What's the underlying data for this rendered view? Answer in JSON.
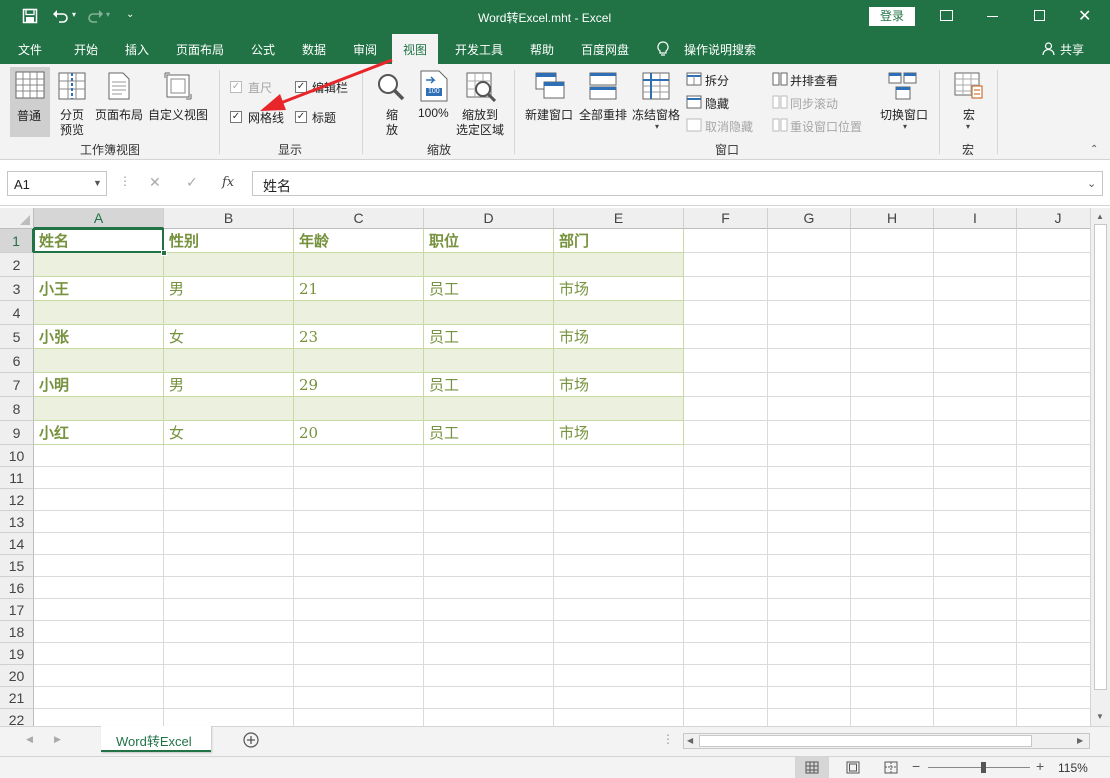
{
  "window": {
    "title": "Word转Excel.mht  -  Excel",
    "login_label": "登录"
  },
  "tabs": [
    "文件",
    "开始",
    "插入",
    "页面布局",
    "公式",
    "数据",
    "审阅",
    "视图",
    "开发工具",
    "帮助",
    "百度网盘"
  ],
  "active_tab": "视图",
  "tell_me": "操作说明搜索",
  "share_label": "共享",
  "ribbon": {
    "workbook_views": {
      "normal": "普通",
      "page_break_line1": "分页",
      "page_break_line2": "预览",
      "page_layout": "页面布局",
      "custom_views": "自定义视图",
      "group_label": "工作簿视图"
    },
    "show": {
      "ruler": "直尺",
      "formula_bar": "编辑栏",
      "gridlines": "网格线",
      "headings": "标题",
      "group_label": "显示"
    },
    "zoom": {
      "zoom_line1": "缩",
      "zoom_line2": "放",
      "hundred": "100%",
      "hundred_icon_text": "100",
      "zoom_sel_line1": "缩放到",
      "zoom_sel_line2": "选定区域",
      "group_label": "缩放"
    },
    "window": {
      "new_window": "新建窗口",
      "arrange_all": "全部重排",
      "freeze_panes": "冻结窗格",
      "split": "拆分",
      "hide": "隐藏",
      "unhide": "取消隐藏",
      "side_by_side": "并排查看",
      "sync_scroll": "同步滚动",
      "reset_position": "重设窗口位置",
      "switch_windows": "切换窗口",
      "group_label": "窗口"
    },
    "macros": {
      "macros": "宏",
      "group_label": "宏"
    }
  },
  "formula_bar": {
    "name_box": "A1",
    "fx": "fx",
    "content": "姓名"
  },
  "sheet": {
    "columns": [
      "A",
      "B",
      "C",
      "D",
      "E",
      "F",
      "G",
      "H",
      "I",
      "J"
    ],
    "rows": [
      "1",
      "2",
      "3",
      "4",
      "5",
      "6",
      "7",
      "8",
      "9",
      "10",
      "11",
      "12",
      "13",
      "14",
      "15",
      "16",
      "17",
      "18",
      "19",
      "20",
      "21",
      "22"
    ],
    "cells": [
      [
        "姓名",
        "性别",
        "年龄",
        "职位",
        "部门"
      ],
      [
        "",
        "",
        "",
        "",
        ""
      ],
      [
        "小王",
        "男",
        "21",
        "员工",
        "市场"
      ],
      [
        "",
        "",
        "",
        "",
        ""
      ],
      [
        "小张",
        "女",
        "23",
        "员工",
        "市场"
      ],
      [
        "",
        "",
        "",
        "",
        ""
      ],
      [
        "小明",
        "男",
        "29",
        "员工",
        "市场"
      ],
      [
        "",
        "",
        "",
        "",
        ""
      ],
      [
        "小红",
        "女",
        "20",
        "员工",
        "市场"
      ]
    ],
    "text_color": "#76923c",
    "band_color": "#ebf1de",
    "selected_cell": "A1"
  },
  "sheet_tabs": [
    "Word转Excel"
  ],
  "status": {
    "zoom": "115%"
  },
  "colors": {
    "brand": "#217346",
    "annotation_arrow": "#e8262a"
  }
}
